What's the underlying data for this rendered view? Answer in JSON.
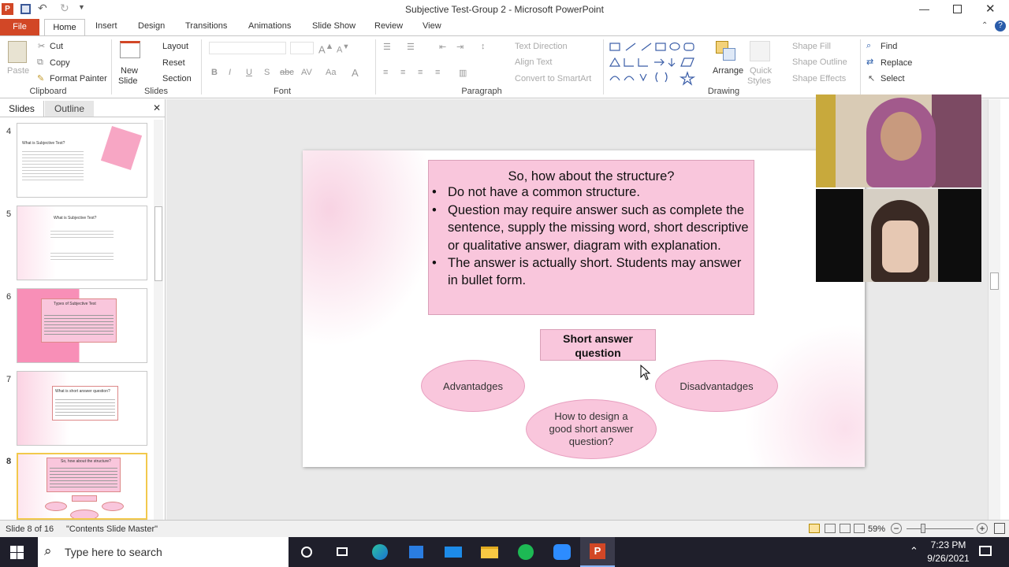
{
  "window": {
    "title": "Subjective Test-Group 2  -  Microsoft PowerPoint"
  },
  "tabs": {
    "file": "File",
    "home": "Home",
    "insert": "Insert",
    "design": "Design",
    "transitions": "Transitions",
    "animations": "Animations",
    "slideshow": "Slide Show",
    "review": "Review",
    "view": "View"
  },
  "ribbon": {
    "clipboard": {
      "paste": "Paste",
      "cut": "Cut",
      "copy": "Copy",
      "format_painter": "Format Painter",
      "label": "Clipboard"
    },
    "slides": {
      "new_slide_1": "New",
      "new_slide_2": "Slide",
      "layout": "Layout",
      "reset": "Reset",
      "section": "Section",
      "label": "Slides"
    },
    "font": {
      "label": "Font"
    },
    "paragraph": {
      "text_direction": "Text Direction",
      "align_text": "Align Text",
      "convert_smartart": "Convert to SmartArt",
      "label": "Paragraph"
    },
    "drawing": {
      "arrange": "Arrange",
      "quick_styles_1": "Quick",
      "quick_styles_2": "Styles",
      "shape_fill": "Shape Fill",
      "shape_outline": "Shape Outline",
      "shape_effects": "Shape Effects",
      "label": "Drawing"
    },
    "editing": {
      "find": "Find",
      "replace": "Replace",
      "select": "Select",
      "label": "Editing"
    }
  },
  "pane": {
    "slides_tab": "Slides",
    "outline_tab": "Outline"
  },
  "thumbnails": [
    {
      "num": "4",
      "title": "What is Subjective    Test?"
    },
    {
      "num": "5",
      "title": "What is Subjective    Test?"
    },
    {
      "num": "6",
      "title": "Types of Subjective    Test"
    },
    {
      "num": "7",
      "title": "What is short  answer question?"
    },
    {
      "num": "8",
      "title": "So, how about the structure?"
    }
  ],
  "slide": {
    "box_title": "So, how about the structure?",
    "bullets": [
      "Do not have a common structure.",
      "Question may require answer such as complete the sentence, supply the missing word, short descriptive or qualitative answer, diagram with explanation.",
      "The answer is actually short. Students may answer in bullet form."
    ],
    "center_box": "Short answer question",
    "left_ellipse": "Advantadges",
    "right_ellipse": "Disadvantadges",
    "bottom_ellipse": "How to design a good short answer question?"
  },
  "status": {
    "slide_info": "Slide 8 of 16",
    "theme": "\"Contents Slide Master\"",
    "zoom": "59%"
  },
  "taskbar": {
    "search_placeholder": "Type here to search",
    "time": "7:23 PM",
    "date": "9/26/2021"
  },
  "colors": {
    "file_tab": "#d24726",
    "slide_pink": "#f9c6dc",
    "taskbar": "#1f1f2b"
  }
}
